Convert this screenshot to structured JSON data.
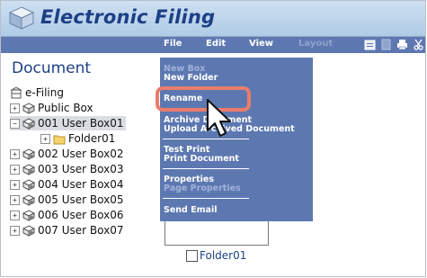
{
  "app": {
    "title": "Electronic Filing"
  },
  "menubar": {
    "items": [
      {
        "label": "File",
        "enabled": true
      },
      {
        "label": "Edit",
        "enabled": true
      },
      {
        "label": "View",
        "enabled": true
      },
      {
        "label": "Layout",
        "enabled": false
      }
    ],
    "tool_icons": [
      "clipboard-icon",
      "page-icon",
      "print-icon",
      "cut-icon"
    ]
  },
  "left_pane": {
    "heading": "Document",
    "tree": [
      {
        "label": "e-Filing",
        "icon": "cabinet-icon"
      },
      {
        "label": "Public Box",
        "icon": "box-icon",
        "expander": "+"
      },
      {
        "label": "001 User Box01",
        "icon": "user-box-icon",
        "expander": "−",
        "selected": true
      },
      {
        "label": "Folder01",
        "icon": "folder-icon",
        "expander": "+"
      },
      {
        "label": "002 User Box02",
        "icon": "user-box-icon",
        "expander": "+"
      },
      {
        "label": "003 User Box03",
        "icon": "user-box-icon",
        "expander": "+"
      },
      {
        "label": "004 User Box04",
        "icon": "user-box-icon",
        "expander": "+"
      },
      {
        "label": "005 User Box05",
        "icon": "user-box-icon",
        "expander": "+"
      },
      {
        "label": "006 User Box06",
        "icon": "user-box-icon",
        "expander": "+"
      },
      {
        "label": "007 User Box07",
        "icon": "user-box-icon",
        "expander": "+"
      }
    ]
  },
  "file_menu": {
    "items": [
      {
        "label": "New Box",
        "enabled": false
      },
      {
        "label": "New Folder",
        "enabled": true
      },
      {
        "label": "Rename",
        "enabled": true,
        "highlighted": true
      },
      {
        "label": "Archive Document",
        "enabled": true
      },
      {
        "label": "Upload Archived Document",
        "enabled": true
      },
      {
        "label": "Test Print",
        "enabled": true
      },
      {
        "label": "Print Document",
        "enabled": true
      },
      {
        "label": "Properties",
        "enabled": true
      },
      {
        "label": "Page Properties",
        "enabled": false
      },
      {
        "label": "Send Email",
        "enabled": true
      }
    ]
  },
  "content": {
    "folder_label": "Folder01",
    "folder_checked": false
  },
  "colors": {
    "menubar": "#5d78b1",
    "title": "#1d3f86",
    "highlight": "#ea7c6c"
  }
}
